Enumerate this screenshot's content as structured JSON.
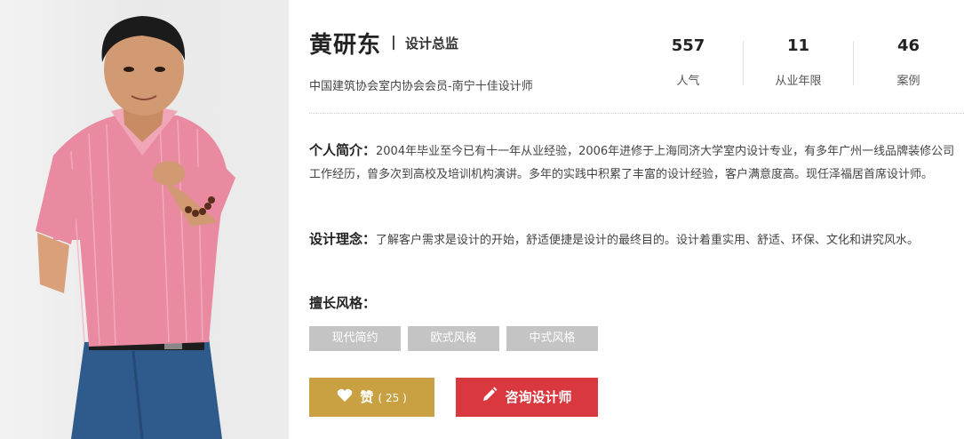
{
  "designer": {
    "name": "黄研东",
    "separator": "|",
    "title": "设计总监",
    "membership": "中国建筑协会室内协会会员-南宁十佳设计师"
  },
  "stats": [
    {
      "value": "557",
      "label": "人气"
    },
    {
      "value": "11",
      "label": "从业年限"
    },
    {
      "value": "46",
      "label": "案例"
    }
  ],
  "intro": {
    "heading": "个人简介：",
    "text": "2004年毕业至今已有十一年从业经验，2006年进修于上海同济大学室内设计专业，有多年广州一线品牌装修公司工作经历，曾多次到高校及培训机构演讲。多年的实践中积累了丰富的设计经验，客户满意度高。现任泽福居首席设计师。"
  },
  "philosophy": {
    "heading": "设计理念：",
    "text": "了解客户需求是设计的开始，舒适便捷是设计的最终目的。设计着重实用、舒适、环保、文化和讲究风水。"
  },
  "styles": {
    "heading": "擅长风格：",
    "tags": [
      "现代简约",
      "欧式风格",
      "中式风格"
    ]
  },
  "actions": {
    "like_label": "赞",
    "like_count": "( 25 )",
    "consult_label": "咨询设计师"
  },
  "icons": {
    "like": "heart-icon",
    "consult": "pencil-icon"
  },
  "colors": {
    "like_button": "#c9a042",
    "consult_button": "#d9383f",
    "tag_bg": "#c4c4c4"
  }
}
